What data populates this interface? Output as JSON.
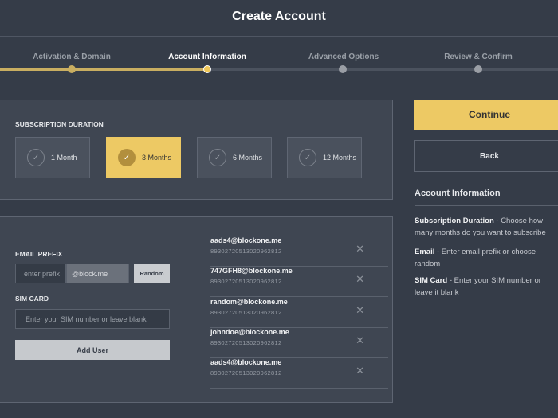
{
  "title": "Create Account",
  "steps": [
    "Activation & Domain",
    "Account Information",
    "Advanced Options",
    "Review & Confirm"
  ],
  "subscription": {
    "label": "SUBSCRIPTION DURATION",
    "options": [
      "1 Month",
      "3 Months",
      "6 Months",
      "12 Months"
    ],
    "selected": "3 Months"
  },
  "form": {
    "email_label": "EMAIL PREFIX",
    "email_placeholder": "enter prefix",
    "domain": "@block.me",
    "random": "Random",
    "sim_label": "SIM CARD",
    "sim_placeholder": "Enter your SIM number or leave blank",
    "add_user": "Add User"
  },
  "users": [
    {
      "email": "aads4@blockone.me",
      "sim": "89302720513020962812"
    },
    {
      "email": "747GFH8@blockone.me",
      "sim": "89302720513020962812"
    },
    {
      "email": "random@blockone.me",
      "sim": "89302720513020962812"
    },
    {
      "email": "johndoe@blockone.me",
      "sim": "89302720513020962812"
    },
    {
      "email": "aads4@blockone.me",
      "sim": "89302720513020962812"
    }
  ],
  "actions": {
    "continue": "Continue",
    "back": "Back"
  },
  "help": {
    "title": "Account Information",
    "items": [
      {
        "term": "Subscription Duration",
        "desc": " - Choose how many months do you want to subscribe"
      },
      {
        "term": "Email",
        "desc": " - Enter email prefix or choose random"
      },
      {
        "term": "SIM Card",
        "desc": " - Enter your SIM number or leave it blank"
      }
    ]
  }
}
